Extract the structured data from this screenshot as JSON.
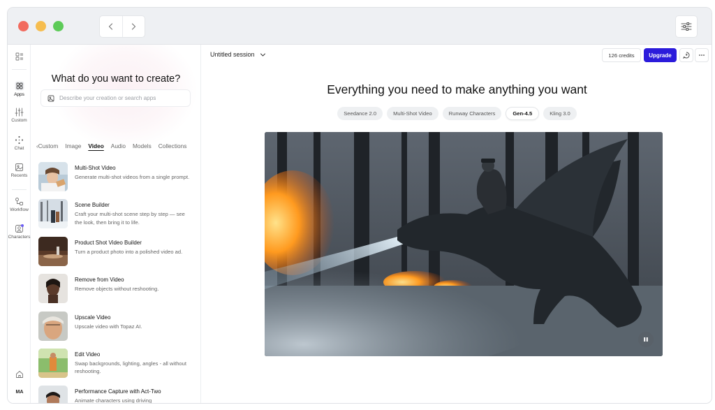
{
  "colors": {
    "accent": "#2b1bdb",
    "traffic_red": "#f26b5e",
    "traffic_yellow": "#f6bd4f",
    "traffic_green": "#5dcb58",
    "notification_dot": "#6b5cf6"
  },
  "titlebar": {
    "back_icon": "chevron-left-icon",
    "forward_icon": "chevron-right-icon",
    "settings_icon": "sliders-icon"
  },
  "rail": {
    "items": [
      {
        "label": "",
        "icon": "layout-icon"
      },
      {
        "label": "Apps",
        "icon": "apps-grid-icon"
      },
      {
        "label": "Custom",
        "icon": "sliders-vertical-icon"
      },
      {
        "label": "Chat",
        "icon": "sparkle-icon"
      },
      {
        "label": "Recents",
        "icon": "images-icon"
      },
      {
        "label": "Workflow",
        "icon": "workflow-icon"
      },
      {
        "label": "Characters",
        "icon": "character-icon"
      }
    ],
    "home_icon": "home-icon",
    "avatar_initials": "MA"
  },
  "panel": {
    "title": "What do you want to create?",
    "search_placeholder": "Describe your creation or search apps",
    "tabs": [
      "Custom",
      "Image",
      "Video",
      "Audio",
      "Models",
      "Collections"
    ],
    "active_tab": "Video",
    "apps": [
      {
        "name": "Multi-Shot Video",
        "desc": "Generate multi-shot videos from a single prompt."
      },
      {
        "name": "Scene Builder",
        "desc": "Craft your multi-shot scene step by step — see the look, then bring it to life."
      },
      {
        "name": "Product Shot Video Builder",
        "desc": "Turn a product photo into a polished video ad."
      },
      {
        "name": "Remove from Video",
        "desc": "Remove objects without reshooting."
      },
      {
        "name": "Upscale Video",
        "desc": "Upscale video with Topaz AI."
      },
      {
        "name": "Edit Video",
        "desc": "Swap backgrounds, lighting, angles - all without reshooting."
      },
      {
        "name": "Performance Capture with Act-Two",
        "desc": "Animate characters using driving"
      }
    ]
  },
  "main": {
    "session_title": "Untitled session",
    "credits": "126 credits",
    "upgrade_label": "Upgrade",
    "headline": "Everything you need to make anything you want",
    "models": [
      "Seedance 2.0",
      "Multi-Shot Video",
      "Runway Characters",
      "Gen-4.5",
      "Kling 3.0"
    ],
    "active_model": "Gen-4.5",
    "video_playing": true
  }
}
